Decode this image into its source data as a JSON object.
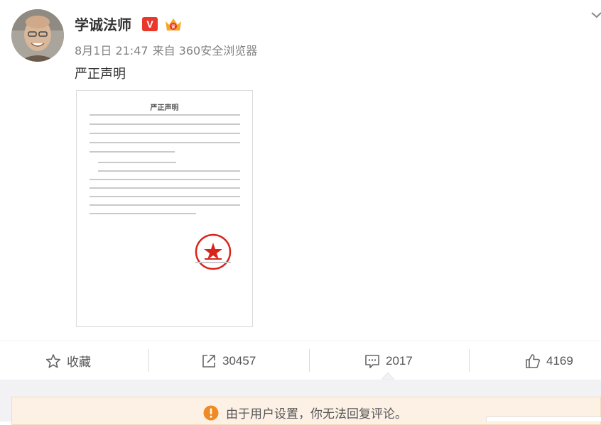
{
  "post": {
    "author": "学诚法师",
    "verified_badge": "V",
    "member_icon": "crown-icon",
    "time": "8月1日 21:47",
    "source": "来自 360安全浏览器",
    "text": "严正声明",
    "image_doc_title": "严正声明"
  },
  "actions": {
    "favorite_label": "收藏",
    "repost_count": "30457",
    "comment_count": "2017",
    "like_count": "4169"
  },
  "notice": {
    "text": "由于用户设置，你无法回复评论。"
  },
  "colors": {
    "verified_red": "#e8382b",
    "notice_bg": "#fdf1e6",
    "notice_icon": "#f08a24",
    "stamp_red": "#d9241b"
  }
}
